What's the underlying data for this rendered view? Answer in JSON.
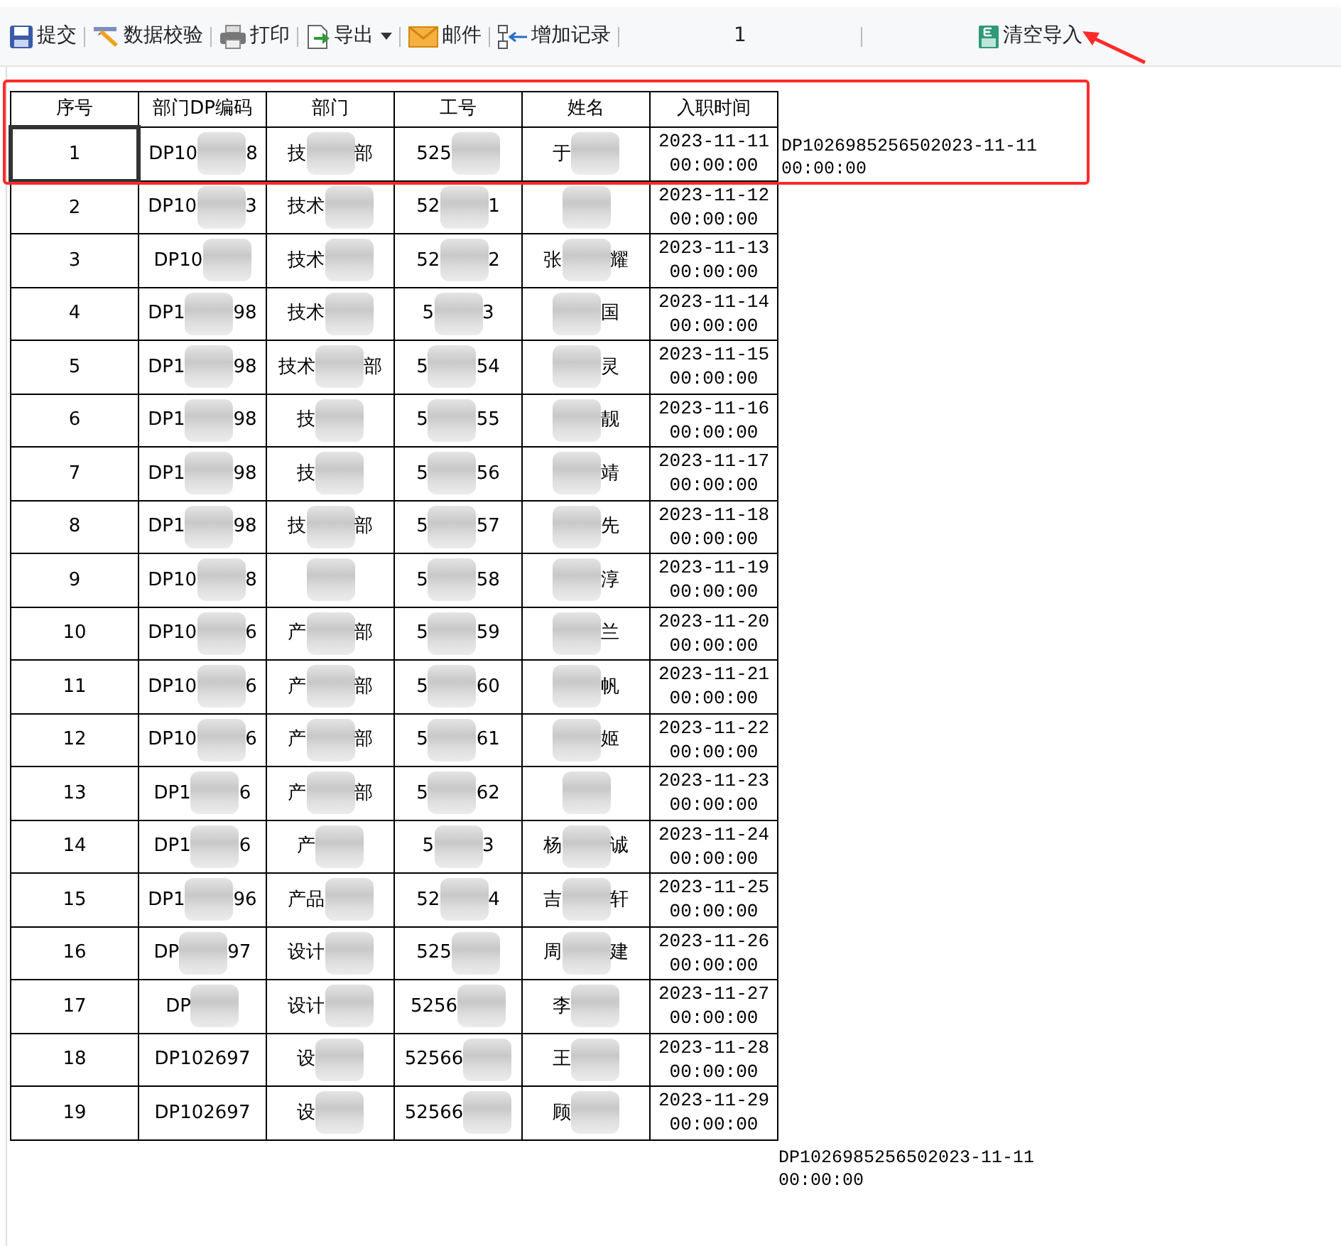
{
  "toolbar": [
    {
      "kind": "save",
      "label": "提交"
    },
    {
      "kind": "validate",
      "label": "数据校验"
    },
    {
      "kind": "print",
      "label": "打印"
    },
    {
      "kind": "export",
      "label": "导出",
      "dropdown": true
    },
    {
      "kind": "mail",
      "label": "邮件"
    },
    {
      "kind": "add",
      "label": "增加记录"
    },
    {
      "kind": "page",
      "label": "1"
    },
    {
      "kind": "clear",
      "label": "清空导入"
    }
  ],
  "table": {
    "columns": [
      "序号",
      "部门DP编码",
      "部门",
      "工号",
      "姓名",
      "入职时间"
    ],
    "rows": [
      {
        "selected": true,
        "cells": [
          "1",
          {
            "before": "DP10",
            "after": "8"
          },
          {
            "before": "技",
            "after": "部"
          },
          {
            "before": "525"
          },
          {
            "before": "于"
          },
          "2023-11-11 00:00:00"
        ]
      },
      {
        "selected": false,
        "cells": [
          "2",
          {
            "before": "DP10",
            "after": "3"
          },
          {
            "before": "技术"
          },
          {
            "before": "52",
            "after": "1"
          },
          {},
          "2023-11-12 00:00:00"
        ]
      },
      {
        "selected": false,
        "cells": [
          "3",
          {
            "before": "DP10"
          },
          {
            "before": "技术"
          },
          {
            "before": "52",
            "after": "2"
          },
          {
            "before": "张",
            "after": "耀"
          },
          "2023-11-13 00:00:00"
        ]
      },
      {
        "selected": false,
        "cells": [
          "4",
          {
            "before": "DP1",
            "after": "98"
          },
          {
            "before": "技术"
          },
          {
            "before": "5",
            "after": "3"
          },
          {
            "after": "国"
          },
          "2023-11-14 00:00:00"
        ]
      },
      {
        "selected": false,
        "cells": [
          "5",
          {
            "before": "DP1",
            "after": "98"
          },
          {
            "before": "技术",
            "after": "部"
          },
          {
            "before": "5",
            "after": "54"
          },
          {
            "after": "灵"
          },
          "2023-11-15 00:00:00"
        ]
      },
      {
        "selected": false,
        "cells": [
          "6",
          {
            "before": "DP1",
            "after": "98"
          },
          {
            "before": "技"
          },
          {
            "before": "5",
            "after": "55"
          },
          {
            "after": "靓"
          },
          "2023-11-16 00:00:00"
        ]
      },
      {
        "selected": false,
        "cells": [
          "7",
          {
            "before": "DP1",
            "after": "98"
          },
          {
            "before": "技"
          },
          {
            "before": "5",
            "after": "56"
          },
          {
            "after": "靖"
          },
          "2023-11-17 00:00:00"
        ]
      },
      {
        "selected": false,
        "cells": [
          "8",
          {
            "before": "DP1",
            "after": "98"
          },
          {
            "before": "技",
            "after": "部"
          },
          {
            "before": "5",
            "after": "57"
          },
          {
            "after": "先"
          },
          "2023-11-18 00:00:00"
        ]
      },
      {
        "selected": false,
        "cells": [
          "9",
          {
            "before": "DP10",
            "after": "8"
          },
          {},
          {
            "before": "5",
            "after": "58"
          },
          {
            "after": "淳"
          },
          "2023-11-19 00:00:00"
        ]
      },
      {
        "selected": false,
        "cells": [
          "10",
          {
            "before": "DP10",
            "after": "6"
          },
          {
            "before": "产",
            "after": "部"
          },
          {
            "before": "5",
            "after": "59"
          },
          {
            "after": "兰"
          },
          "2023-11-20 00:00:00"
        ]
      },
      {
        "selected": false,
        "cells": [
          "11",
          {
            "before": "DP10",
            "after": "6"
          },
          {
            "before": "产",
            "after": "部"
          },
          {
            "before": "5",
            "after": "60"
          },
          {
            "after": "帆"
          },
          "2023-11-21 00:00:00"
        ]
      },
      {
        "selected": false,
        "cells": [
          "12",
          {
            "before": "DP10",
            "after": "6"
          },
          {
            "before": "产",
            "after": "部"
          },
          {
            "before": "5",
            "after": "61"
          },
          {
            "after": "姬"
          },
          "2023-11-22 00:00:00"
        ]
      },
      {
        "selected": false,
        "cells": [
          "13",
          {
            "before": "DP1",
            "after": "6"
          },
          {
            "before": "产",
            "after": "部"
          },
          {
            "before": "5",
            "after": "62"
          },
          {},
          "2023-11-23 00:00:00"
        ]
      },
      {
        "selected": false,
        "cells": [
          "14",
          {
            "before": "DP1",
            "after": "6"
          },
          {
            "before": "产"
          },
          {
            "before": "5",
            "after": "3"
          },
          {
            "before": "杨",
            "after": "诚"
          },
          "2023-11-24 00:00:00"
        ]
      },
      {
        "selected": false,
        "cells": [
          "15",
          {
            "before": "DP1",
            "after": "96"
          },
          {
            "before": "产品"
          },
          {
            "before": "52",
            "after": "4"
          },
          {
            "before": "吉",
            "after": "轩"
          },
          "2023-11-25 00:00:00"
        ]
      },
      {
        "selected": false,
        "cells": [
          "16",
          {
            "before": "DP",
            "after": "97"
          },
          {
            "before": "设计"
          },
          {
            "before": "525"
          },
          {
            "before": "周",
            "after": "建"
          },
          "2023-11-26 00:00:00"
        ]
      },
      {
        "selected": false,
        "cells": [
          "17",
          {
            "before": "DP"
          },
          {
            "before": "设计"
          },
          {
            "before": "5256"
          },
          {
            "before": "李"
          },
          "2023-11-27 00:00:00"
        ]
      },
      {
        "selected": false,
        "cells": [
          "18",
          "DP102697",
          {
            "before": "设"
          },
          {
            "before": "52566"
          },
          {
            "before": "王"
          },
          "2023-11-28 00:00:00"
        ]
      },
      {
        "selected": false,
        "cells": [
          "19",
          "DP102697",
          {
            "before": "设"
          },
          {
            "before": "52566"
          },
          {
            "before": "顾"
          },
          "2023-11-29 00:00:00"
        ]
      }
    ]
  },
  "side_note": "DP1026985256502023-11-11 00:00:00",
  "footer_note": "DP1026985256502023-11-11 00:00:00"
}
